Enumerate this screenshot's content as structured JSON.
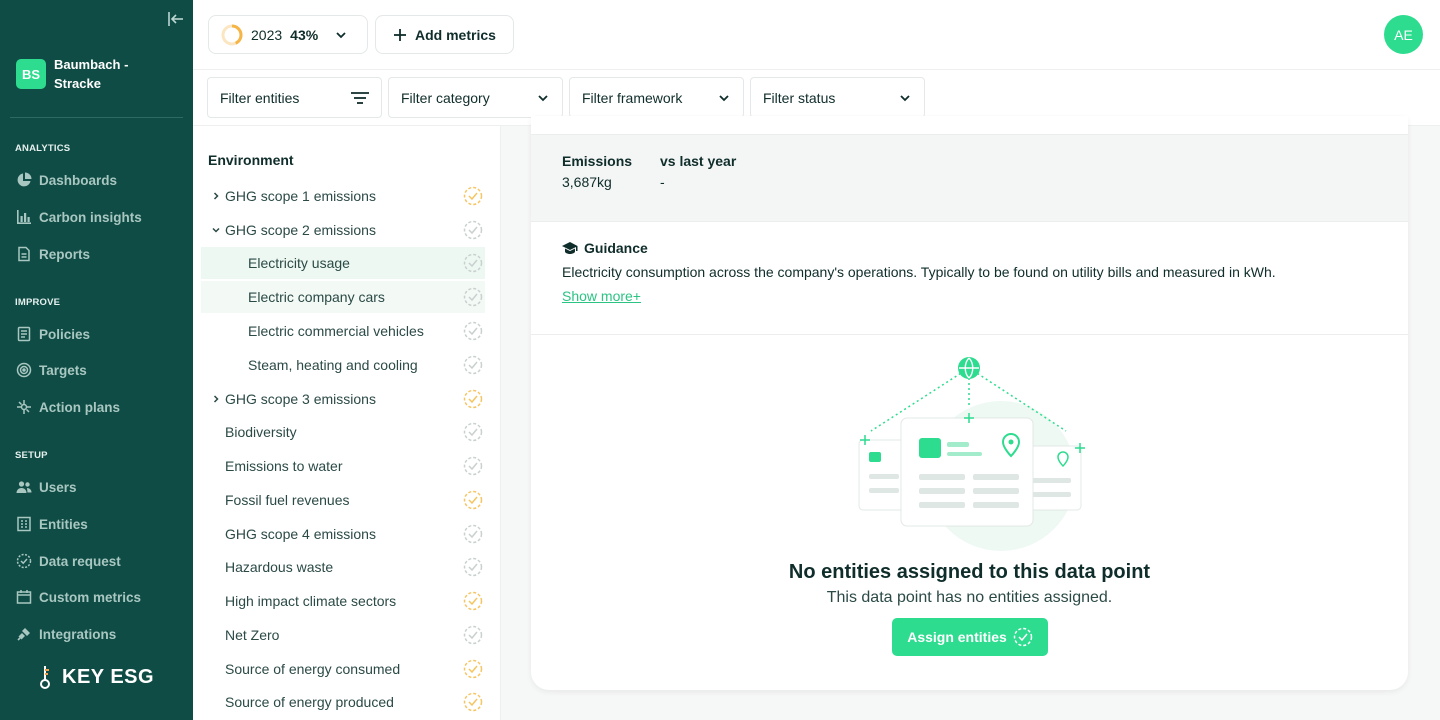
{
  "sidebar": {
    "org_initials": "BS",
    "org_name": "Baumbach - Stracke",
    "sections": {
      "analytics": "ANALYTICS",
      "improve": "IMPROVE",
      "setup": "SETUP"
    },
    "items": [
      {
        "label": "Dashboards",
        "icon": "pie-chart-icon"
      },
      {
        "label": "Carbon insights",
        "icon": "bar-chart-icon"
      },
      {
        "label": "Reports",
        "icon": "document-icon"
      },
      {
        "label": "Policies",
        "icon": "policy-icon"
      },
      {
        "label": "Targets",
        "icon": "target-icon"
      },
      {
        "label": "Action plans",
        "icon": "action-plan-icon"
      },
      {
        "label": "Users",
        "icon": "users-icon"
      },
      {
        "label": "Entities",
        "icon": "entities-icon"
      },
      {
        "label": "Data request",
        "icon": "data-request-icon"
      },
      {
        "label": "Custom metrics",
        "icon": "custom-metrics-icon"
      },
      {
        "label": "Integrations",
        "icon": "integrations-icon"
      }
    ],
    "brand": "KEY ESG"
  },
  "topbar": {
    "year": "2023",
    "progress": "43%",
    "progress_fraction": 0.43,
    "add_metrics": "Add metrics",
    "avatar": "AE"
  },
  "filters": {
    "entities": "Filter entities",
    "category": "Filter category",
    "framework": "Filter framework",
    "status": "Filter status"
  },
  "tree": {
    "heading": "Environment",
    "rows": [
      {
        "label": "GHG scope 1 emissions",
        "status": "partial"
      },
      {
        "label": "GHG scope 2 emissions",
        "status": "empty"
      },
      {
        "label": "Electricity usage",
        "status": "empty"
      },
      {
        "label": "Electric company cars",
        "status": "empty"
      },
      {
        "label": "Electric commercial vehicles",
        "status": "empty"
      },
      {
        "label": "Steam, heating and cooling",
        "status": "empty"
      },
      {
        "label": "GHG scope 3 emissions",
        "status": "partial"
      },
      {
        "label": "Biodiversity",
        "status": "empty"
      },
      {
        "label": "Emissions to water",
        "status": "empty"
      },
      {
        "label": "Fossil fuel revenues",
        "status": "partial"
      },
      {
        "label": "GHG scope 4 emissions",
        "status": "empty"
      },
      {
        "label": "Hazardous waste",
        "status": "empty"
      },
      {
        "label": "High impact climate sectors",
        "status": "partial"
      },
      {
        "label": "Net Zero",
        "status": "empty"
      },
      {
        "label": "Source of energy consumed",
        "status": "partial"
      },
      {
        "label": "Source of energy produced",
        "status": "partial"
      }
    ]
  },
  "detail": {
    "emissions_label": "Emissions",
    "emissions_value": "3,687kg",
    "vs_label": "vs last year",
    "vs_value": "-",
    "guidance_title": "Guidance",
    "guidance_text": "Electricity consumption across the company's operations. Typically to be found on utility bills and measured in kWh.",
    "show_more": "Show more+",
    "empty_title": "No entities assigned to this data point",
    "empty_sub": "This data point has no entities assigned.",
    "assign_button": "Assign entities"
  },
  "colors": {
    "sidebar_bg": "#0f4c45",
    "accent": "#2ddc8f",
    "partial": "#f5c562",
    "empty": "#c9d0cf"
  }
}
